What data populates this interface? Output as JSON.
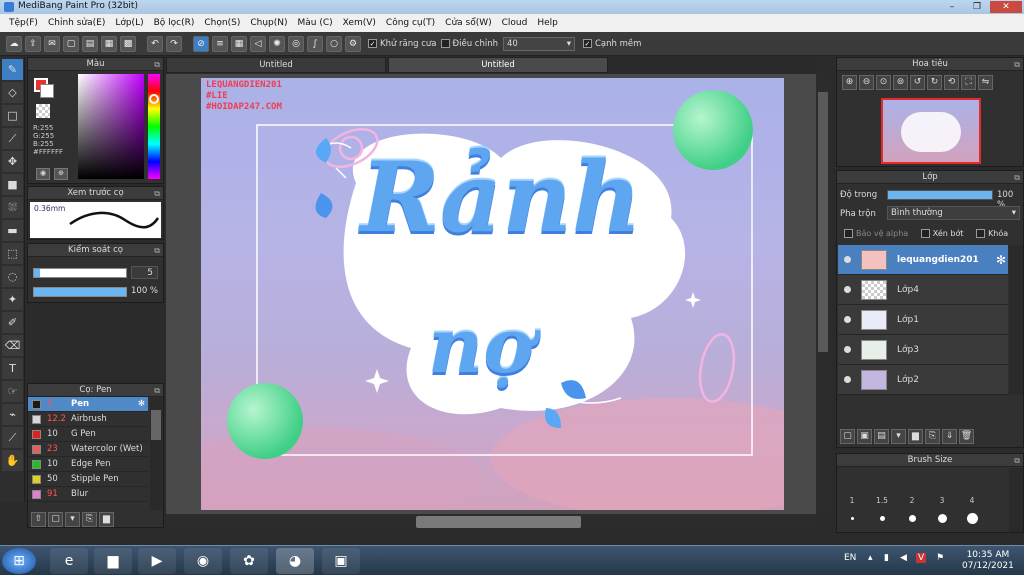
{
  "window": {
    "title": "MediBang Paint Pro (32bit)",
    "minimize": "–",
    "maximize": "❐",
    "close": "✕"
  },
  "menu": [
    "Tệp(F)",
    "Chỉnh sửa(E)",
    "Lớp(L)",
    "Bộ lọc(R)",
    "Chọn(S)",
    "Chụp(N)",
    "Màu (C)",
    "Xem(V)",
    "Công cụ(T)",
    "Cửa sổ(W)",
    "Cloud",
    "Help"
  ],
  "toolbar": {
    "antialias_label": "Khử răng cưa",
    "adjust_label": "Điều chỉnh",
    "adjust_value": "40",
    "edge_label": "Cạnh mềm"
  },
  "tabs": [
    "Untitled",
    "Untitled"
  ],
  "color_panel": {
    "title": "Màu",
    "r": "R:255",
    "g": "G:255",
    "b": "B:255",
    "hex": "#FFFFFF"
  },
  "brush_preview": {
    "title": "Xem trước cọ",
    "size": "0.36mm"
  },
  "brush_control": {
    "title": "Kiểm soát cọ",
    "size_value": "5",
    "opacity_value": "100 %",
    "opacity_fraction": 1.0
  },
  "brush_list": {
    "title": "Cọ: Pen",
    "items": [
      {
        "size": "5",
        "name": "Pen",
        "color": "#1a1a1a",
        "selected": true
      },
      {
        "size": "12.2",
        "name": "Airbrush",
        "color": "#d8d8d8",
        "selected": false
      },
      {
        "size": "10",
        "name": "G Pen",
        "color": "#e02020",
        "selected": false
      },
      {
        "size": "23",
        "name": "Watercolor (Wet)",
        "color": "#e06060",
        "selected": false
      },
      {
        "size": "10",
        "name": "Edge Pen",
        "color": "#20c020",
        "selected": false
      },
      {
        "size": "50",
        "name": "Stipple Pen",
        "color": "#e0d020",
        "selected": false
      },
      {
        "size": "91",
        "name": "Blur",
        "color": "#e080d0",
        "selected": false
      }
    ]
  },
  "navigator": {
    "title": "Hoa tiêu"
  },
  "layers": {
    "title": "Lớp",
    "opacity_label": "Độ trong",
    "opacity_value": "100 %",
    "opacity_fraction": 1.0,
    "blend_label": "Pha trộn",
    "blend_value": "Bình thường",
    "alpha_lock": "Bảo vệ alpha",
    "clip": "Xén bớt",
    "lock": "Khóa",
    "items": [
      {
        "name": "lequangdien201",
        "selected": true
      },
      {
        "name": "Lớp4",
        "selected": false
      },
      {
        "name": "Lớp1",
        "selected": false
      },
      {
        "name": "Lớp3",
        "selected": false
      },
      {
        "name": "Lớp2",
        "selected": false
      }
    ]
  },
  "brush_size": {
    "title": "Brush Size",
    "labels": [
      "1",
      "1.5",
      "2",
      "3",
      "4"
    ]
  },
  "artwork": {
    "watermark": [
      "LEQUANGDIEN201",
      "#LIE",
      "#HOIDAP247.COM"
    ],
    "line1": "Rảnh",
    "line2": "nợ"
  },
  "taskbar": {
    "lang": "EN",
    "time": "10:35 AM",
    "date": "07/12/2021"
  }
}
